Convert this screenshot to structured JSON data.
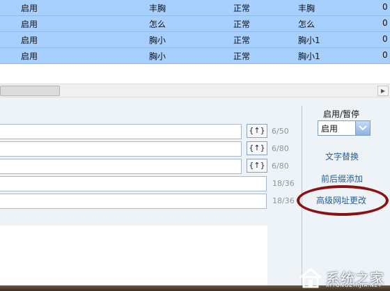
{
  "table": {
    "rows": [
      {
        "status": "启用",
        "keyword": "丰胸",
        "state": "正常",
        "replace": "丰胸",
        "extra": "0"
      },
      {
        "status": "启用",
        "keyword": "怎么",
        "state": "正常",
        "replace": "怎么",
        "extra": "0"
      },
      {
        "status": "启用",
        "keyword": "胸小",
        "state": "正常",
        "replace": "胸小1",
        "extra": "0"
      },
      {
        "status": "启用",
        "keyword": "胸小",
        "state": "正常",
        "replace": "胸小1",
        "extra": "0"
      }
    ]
  },
  "form": {
    "updown_label": "{↑}",
    "counters": [
      "6/50",
      "6/80",
      "6/80",
      "18/36",
      "18/36"
    ]
  },
  "panel": {
    "status_label": "启用/暂停",
    "status_value": "启用",
    "link_text_replace": "文字替换",
    "link_prefix_suffix": "前后缀添加",
    "link_advanced_url": "高级网址更改"
  },
  "watermark": {
    "text": "系统之家",
    "url": "XITONGZHIJIA.NET"
  },
  "colors": {
    "row_selected": "#a8d0ff",
    "link": "#2a5d94",
    "highlight_oval": "#8b1212"
  }
}
